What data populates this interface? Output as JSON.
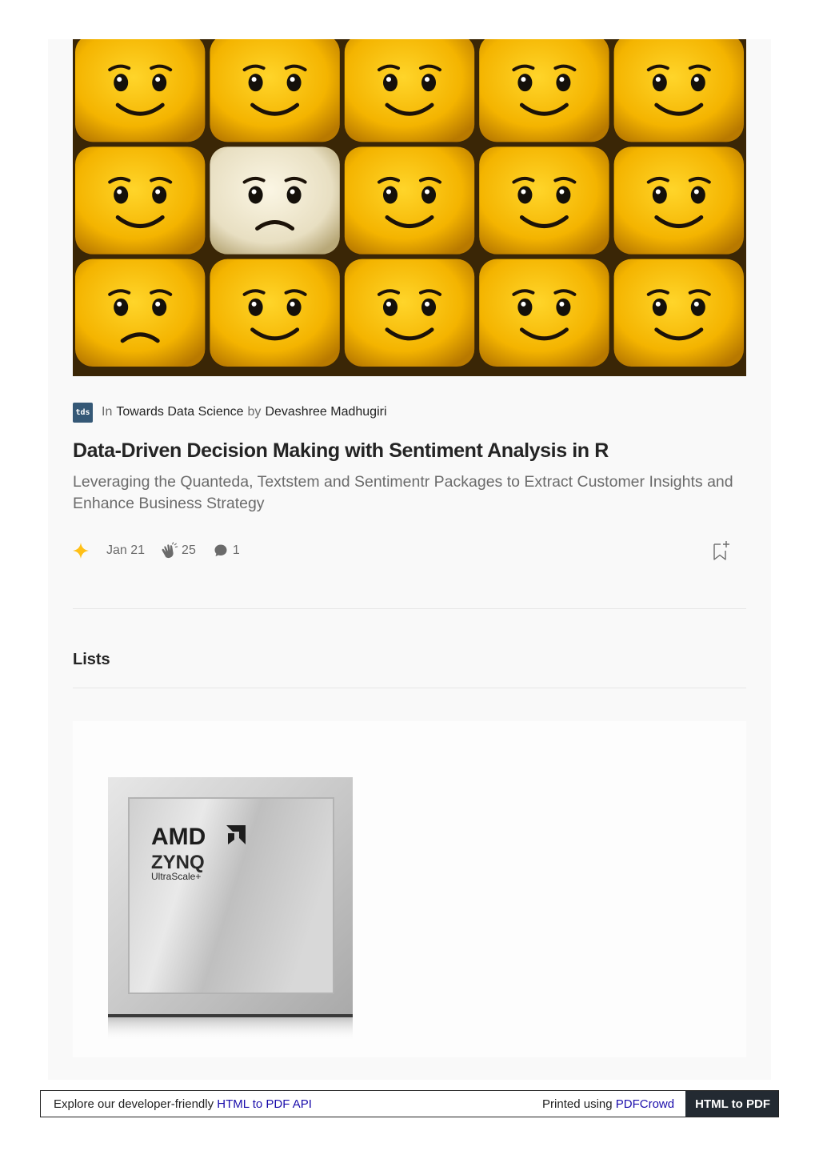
{
  "article": {
    "publication_prefix": "In",
    "publication": "Towards Data Science",
    "author_prefix": "by",
    "author": "Devashree Madhugiri",
    "publication_logo_text": "tds",
    "title": "Data-Driven Decision Making with Sentiment Analysis in R",
    "subtitle": "Leveraging the Quanteda, Textstem and Sentimentr Packages to Extract Customer Insights and Enhance Business Strategy",
    "date": "Jan 21",
    "claps": "25",
    "comments": "1"
  },
  "icons": {
    "member_star": "star-icon",
    "clap": "clap-icon",
    "comment": "comment-icon",
    "bookmark": "bookmark-add-icon"
  },
  "lists": {
    "heading": "Lists"
  },
  "chip_image": {
    "brand": "AMD",
    "product": "ZYNQ",
    "line": "UltraScale+"
  },
  "footer": {
    "left_text": "Explore our developer-friendly ",
    "left_link": "HTML to PDF API",
    "right_text": "Printed using ",
    "right_link": "PDFCrowd",
    "badge": "HTML to PDF"
  },
  "colors": {
    "star": "#FFC017",
    "publication_logo_bg": "#355876",
    "link": "#1a0dab",
    "footer_badge_bg": "#232a32"
  }
}
